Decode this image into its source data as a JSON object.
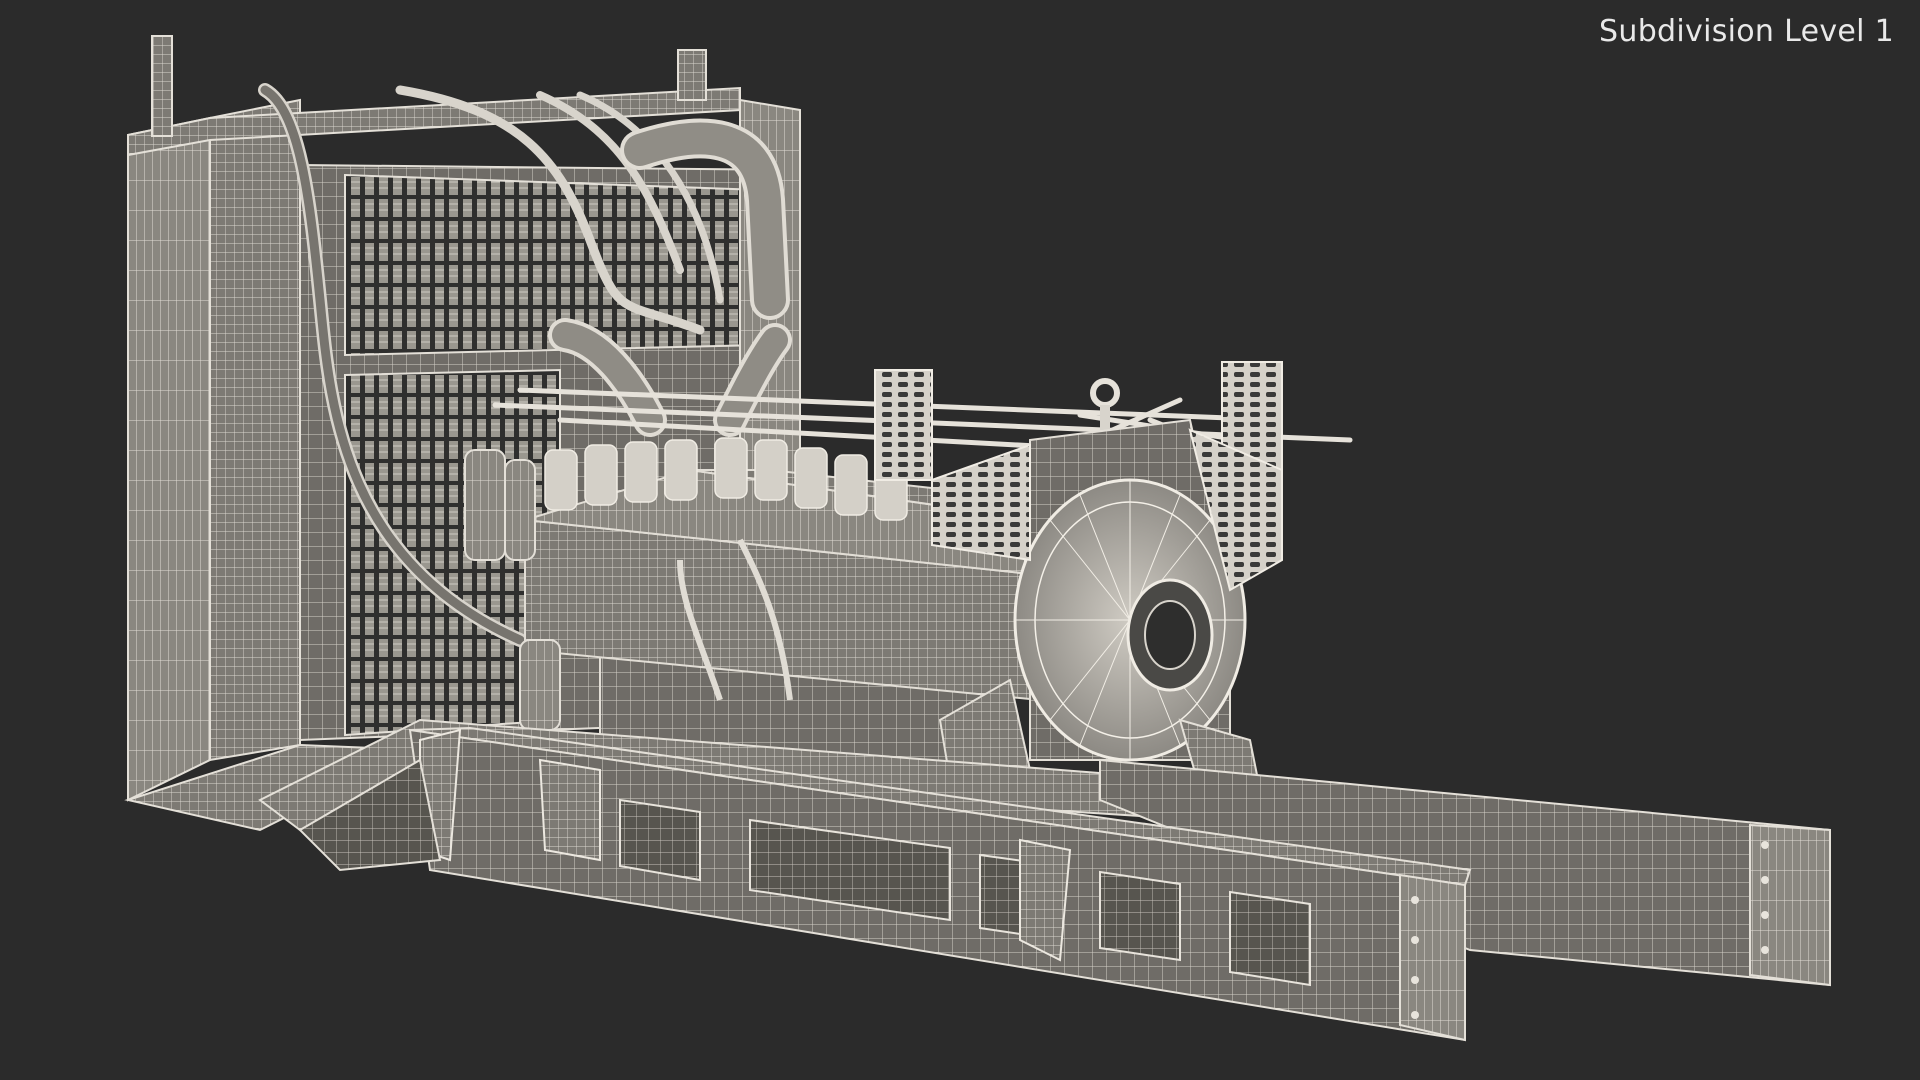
{
  "viewport": {
    "subdivision_label": "Subdivision Level 1",
    "background_color": "#2b2b2b",
    "wire_color": "#d8d4cc",
    "surface_color": "#8f8c86"
  },
  "model": {
    "subject": "generator-set-wireframe",
    "parts": [
      "radiator",
      "cooling-pipes",
      "v-engine-block",
      "alternator-flywheel",
      "lifting-eye",
      "base-frame-skid"
    ]
  }
}
